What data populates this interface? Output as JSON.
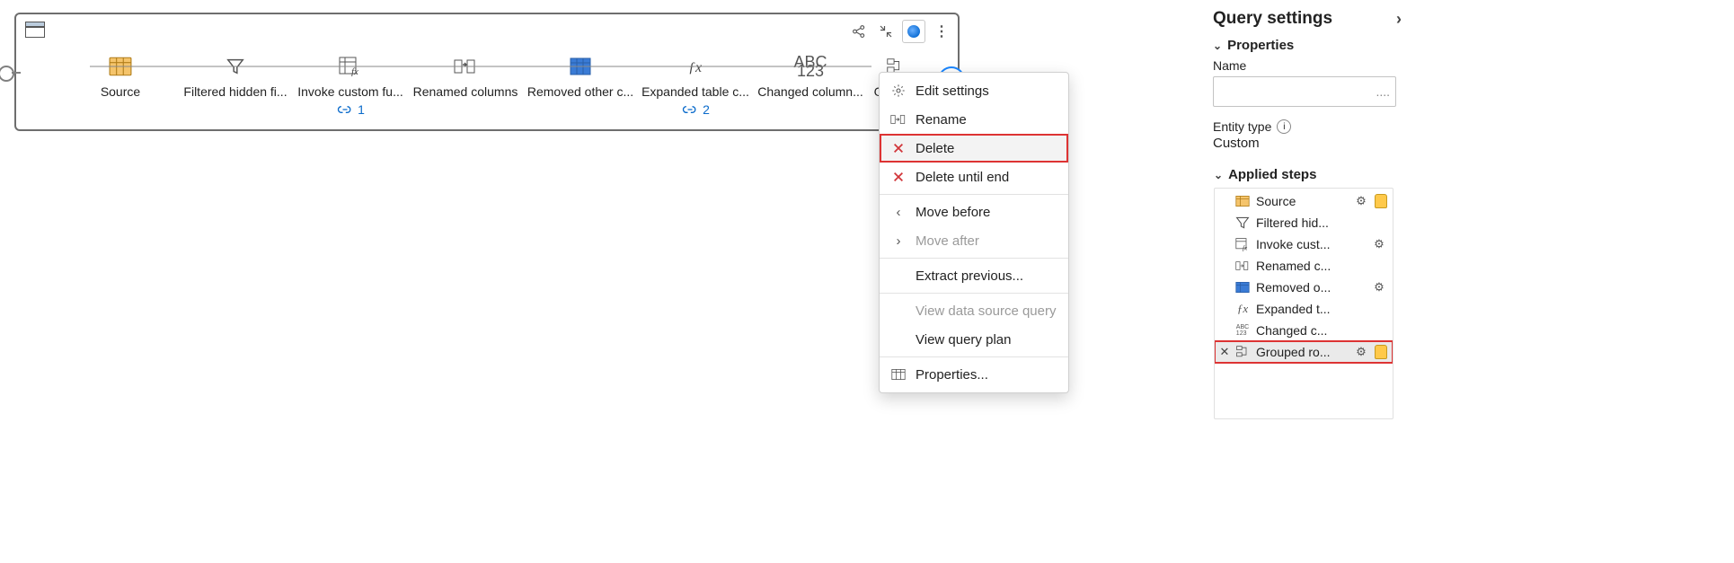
{
  "canvas": {
    "toolbar": {
      "share_icon": "share-icon",
      "collapse_icon": "collapse-icon",
      "dataverse_icon": "dataverse-icon",
      "more_icon": "more-icon"
    },
    "steps": [
      {
        "label": "Source",
        "icon": "table"
      },
      {
        "label": "Filtered hidden fi...",
        "icon": "filter"
      },
      {
        "label": "Invoke custom fu...",
        "icon": "table-fx",
        "badge": "1"
      },
      {
        "label": "Renamed columns",
        "icon": "rename"
      },
      {
        "label": "Removed other c...",
        "icon": "table-blue"
      },
      {
        "label": "Expanded table c...",
        "icon": "fx",
        "badge": "2"
      },
      {
        "label": "Changed column...",
        "icon": "abc123"
      },
      {
        "label": "Groupe",
        "icon": "group"
      }
    ],
    "add_step_label": "+"
  },
  "context_menu": {
    "items": [
      {
        "icon": "gear",
        "label": "Edit settings"
      },
      {
        "icon": "rename",
        "label": "Rename"
      },
      {
        "icon": "x-red",
        "label": "Delete",
        "highlight": true
      },
      {
        "icon": "x-red",
        "label": "Delete until end"
      },
      {
        "sep": true
      },
      {
        "icon": "chev-left",
        "label": "Move before"
      },
      {
        "icon": "chev-right",
        "label": "Move after",
        "disabled": true
      },
      {
        "sep": true
      },
      {
        "icon": "",
        "label": "Extract previous..."
      },
      {
        "sep": true
      },
      {
        "icon": "",
        "label": "View data source query",
        "disabled": true
      },
      {
        "icon": "",
        "label": "View query plan"
      },
      {
        "sep": true
      },
      {
        "icon": "table",
        "label": "Properties..."
      }
    ]
  },
  "settings": {
    "title": "Query settings",
    "properties_title": "Properties",
    "name_label": "Name",
    "name_value": "....",
    "entity_type_label": "Entity type",
    "entity_type_value": "Custom",
    "applied_steps_title": "Applied steps",
    "steps": [
      {
        "icon": "table",
        "label": "Source",
        "gear": true,
        "db": true
      },
      {
        "icon": "filter",
        "label": "Filtered hid..."
      },
      {
        "icon": "table-fx",
        "label": "Invoke cust...",
        "gear": true
      },
      {
        "icon": "rename",
        "label": "Renamed c..."
      },
      {
        "icon": "table-blue",
        "label": "Removed o...",
        "gear": true
      },
      {
        "icon": "fx",
        "label": "Expanded t..."
      },
      {
        "icon": "abc123",
        "label": "Changed c..."
      },
      {
        "icon": "group",
        "label": "Grouped ro...",
        "gear": true,
        "db": true,
        "x": true,
        "selected": true,
        "red": true
      }
    ]
  }
}
